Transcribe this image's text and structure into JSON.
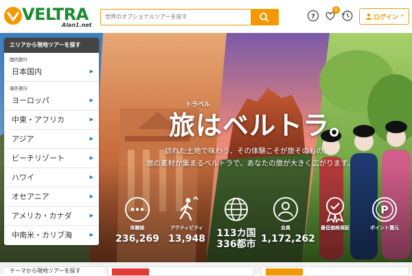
{
  "header": {
    "logo_text": "VELTRA",
    "logo_sub": "Alan1.net",
    "search_placeholder": "世界のオプショナルツアーを探す",
    "notification_count": "0",
    "login_label": "ログイン"
  },
  "menu": {
    "title": "エリアから現地ツアーを探す",
    "domestic_label": "国内旅行",
    "domestic_items": [
      "日本国内"
    ],
    "overseas_label": "海外旅行",
    "overseas_items": [
      "ヨーロッパ",
      "中東・アフリカ",
      "アジア",
      "ビーチリゾート",
      "ハワイ",
      "オセアニア",
      "アメリカ・カナダ",
      "中南米・カリブ海"
    ]
  },
  "hero": {
    "ruby": "トラベル",
    "headline": "旅はベルトラ。",
    "sub1": "訪れた土地で味わう、その体験こそが旅そのもの。",
    "sub2": "旅の素材が集まるベルトラで、あなたの旅が大きく広がります。"
  },
  "stats": [
    {
      "icon": "chat-bubble-icon",
      "label": "体験談",
      "value": "236,269"
    },
    {
      "icon": "hiker-icon",
      "label": "アクティビティ",
      "value": "13,948"
    },
    {
      "icon": "globe-icon",
      "label": "113カ国",
      "value": "336都市"
    },
    {
      "icon": "user-icon",
      "label": "会員",
      "value": "1,172,262"
    },
    {
      "icon": "medal-check-icon",
      "label": "最低価格保証",
      "value": ""
    },
    {
      "icon": "points-icon",
      "label": "ポイント還元",
      "value": ""
    }
  ],
  "bottom": {
    "theme_title": "テーマから現地ツアーを探す"
  },
  "colors": {
    "brand_orange": "#f39800",
    "brand_green": "#1a8a2e",
    "link_blue": "#1d78c5"
  }
}
